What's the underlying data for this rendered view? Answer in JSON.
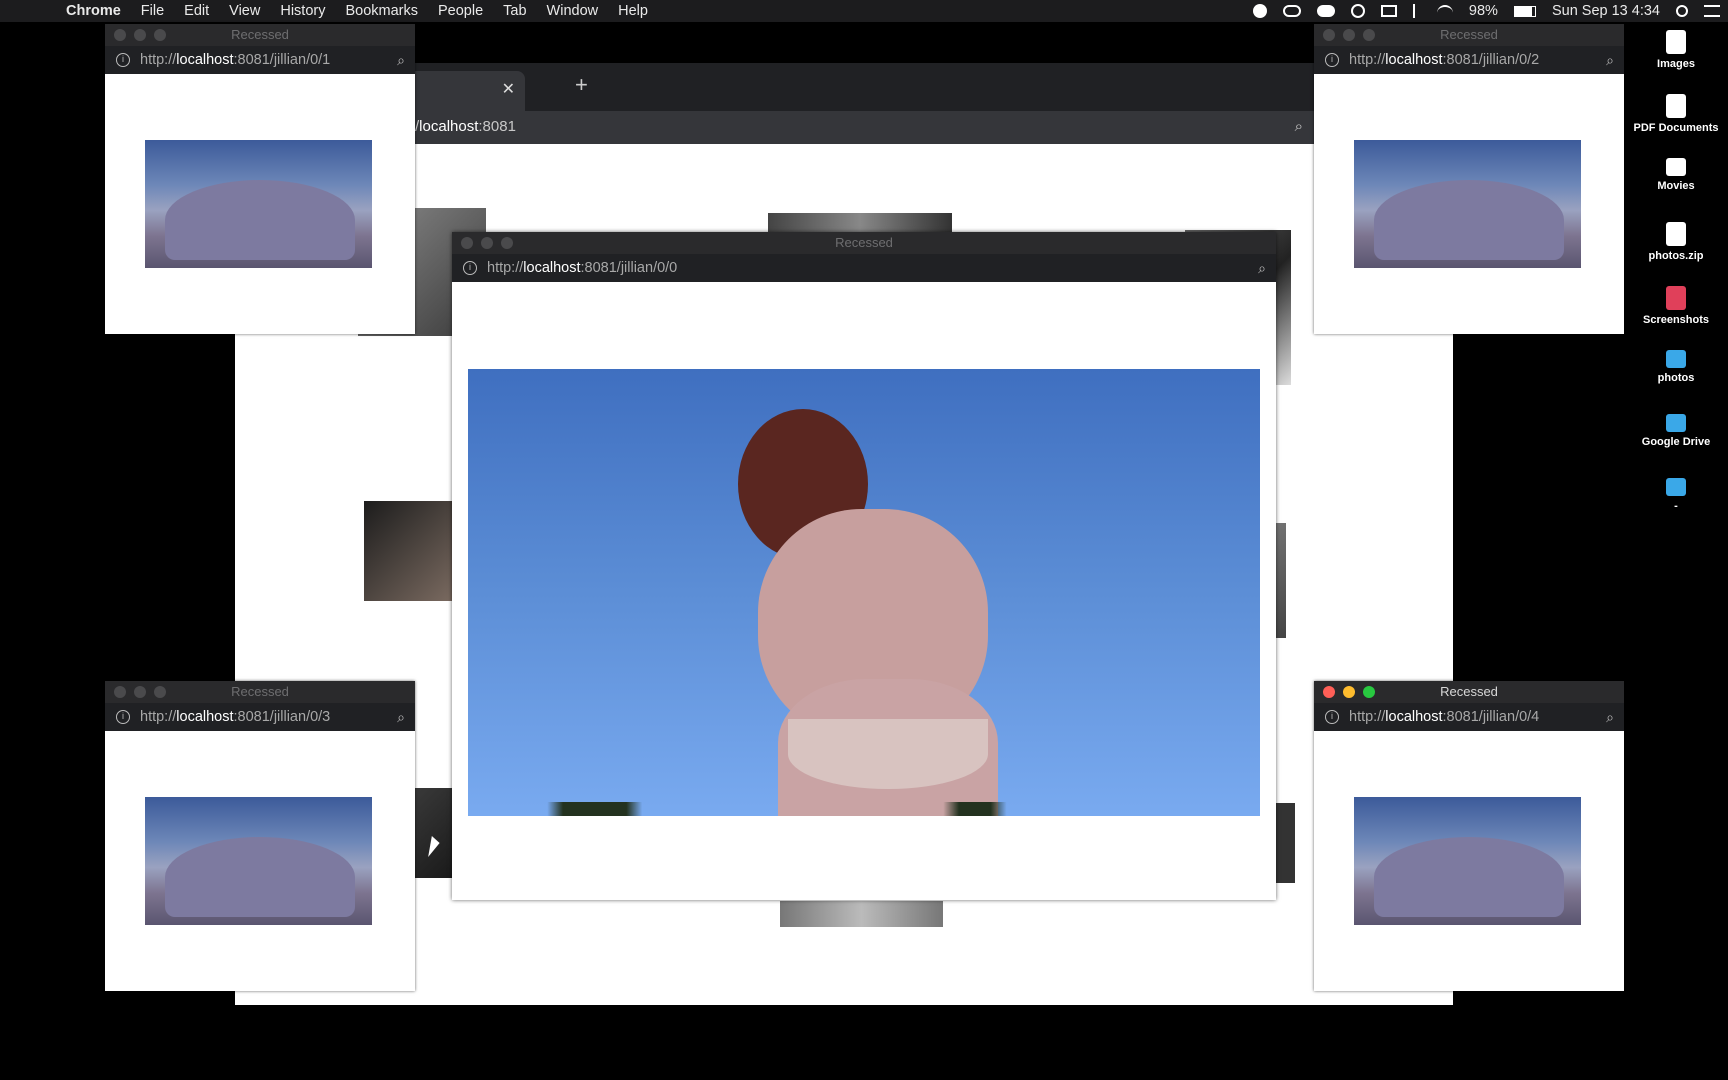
{
  "menubar": {
    "app": "Chrome",
    "items": [
      "File",
      "Edit",
      "View",
      "History",
      "Bookmarks",
      "People",
      "Tab",
      "Window",
      "Help"
    ],
    "battery": "98%",
    "datetime": "Sun Sep 13  4:34"
  },
  "desktop": {
    "icons": [
      "Images",
      "PDF Documents",
      "Movies",
      "photos.zip",
      "Screenshots",
      "photos",
      "Google Drive",
      "-"
    ],
    "icon_colors": [
      "#ffffff",
      "#ffffff",
      "#ffffff",
      "#ffffff",
      "#e0405a",
      "#3aa8e8",
      "#3aa8e8",
      "#3aa8e8"
    ]
  },
  "main_window": {
    "tab_close": "✕",
    "new_tab": "+",
    "url_host": "localhost",
    "url_tail": ":8081",
    "url_prefix": "/"
  },
  "popups": [
    {
      "title": "Recessed",
      "scheme": "http://",
      "host": "localhost",
      "path": ":8081/jillian/0/1"
    },
    {
      "title": "Recessed",
      "scheme": "http://",
      "host": "localhost",
      "path": ":8081/jillian/0/2"
    },
    {
      "title": "Recessed",
      "scheme": "http://",
      "host": "localhost",
      "path": ":8081/jillian/0/3"
    },
    {
      "title": "Recessed",
      "scheme": "http://",
      "host": "localhost",
      "path": ":8081/jillian/0/4"
    }
  ],
  "center_window": {
    "title": "Recessed",
    "scheme": "http://",
    "host": "localhost",
    "path": ":8081/jillian/0/0"
  },
  "icons": {
    "info": "i",
    "zoom": "⌕",
    "apple": ""
  }
}
